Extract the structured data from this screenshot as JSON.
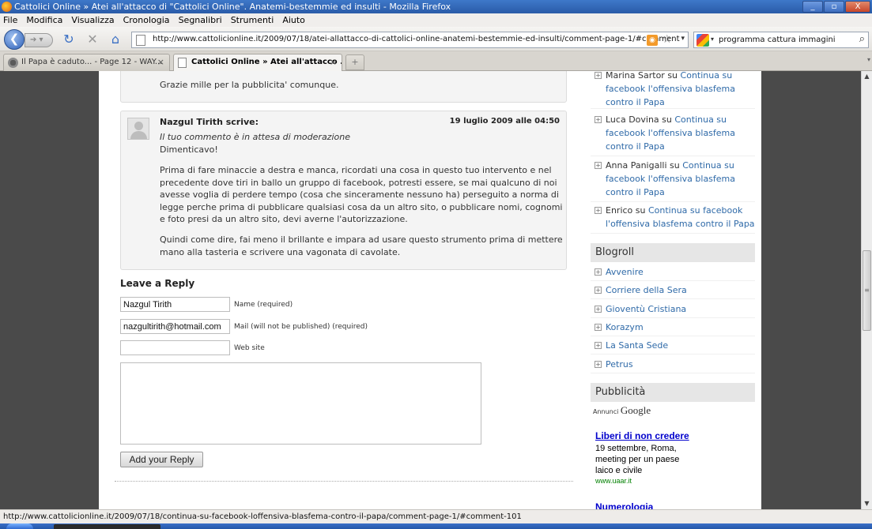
{
  "window": {
    "title": "Cattolici Online » Atei all'attacco di \"Cattolici Online\". Anatemi-bestemmie ed insulti - Mozilla Firefox",
    "minimize": "_",
    "maximize": "▫",
    "close": "X"
  },
  "menu": [
    "File",
    "Modifica",
    "Visualizza",
    "Cronologia",
    "Segnalibri",
    "Strumenti",
    "Aiuto"
  ],
  "nav": {
    "url": "http://www.cattolicionline.it/2009/07/18/atei-allattacco-di-cattolici-online-anatemi-bestemmie-ed-insulti/comment-page-1/#comment",
    "search_value": "programma cattura immagini"
  },
  "tabs": [
    {
      "label": "Il Papa è caduto... - Page 12 - WAY...",
      "close": "×"
    },
    {
      "label": "Cattolici Online » Atei all'attacco ...",
      "close": "×"
    }
  ],
  "new_tab": "+",
  "prev_comment": {
    "text": "Grazie mille per la pubblicita' comunque."
  },
  "comment": {
    "author": "Nazgul Tirith scrive:",
    "date": "19 luglio 2009 alle 04:50",
    "moderation": "Il tuo commento è in attesa di moderazione",
    "line1": "Dimenticavo!",
    "para1": "Prima di fare minaccie a destra e manca, ricordati una cosa in questo tuo intervento e nel precedente dove tiri in ballo un gruppo di facebook, potresti essere, se mai qualcuno di noi avesse voglia di perdere tempo (cosa che sinceramente nessuno ha) perseguito a norma di legge perche prima di pubblicare qualsiasi cosa da un altro sito, o pubblicare nomi, cognomi e foto presi da un altro sito, devi averne l'autorizzazione.",
    "para2": "Quindi come dire, fai meno il brillante e impara ad usare questo strumento prima di mettere mano alla tasteria e scrivere una vagonata di cavolate."
  },
  "reply": {
    "title": "Leave a Reply",
    "name_value": "Nazgul Tirith",
    "name_label": "Name (required)",
    "mail_value": "nazgultirith@hotmail.com",
    "mail_label": "Mail (will not be published) (required)",
    "website_value": "",
    "website_label": "Web site",
    "submit_label": "Add your Reply"
  },
  "sidebar": {
    "recent_comments": [
      {
        "who": "Marina Sartor su ",
        "link": "Continua su facebook l'offensiva blasfema contro il Papa"
      },
      {
        "who": "Luca Dovina su ",
        "link": "Continua su facebook l'offensiva blasfema contro il Papa"
      },
      {
        "who": "Anna Panigalli su ",
        "link": "Continua su facebook l'offensiva blasfema contro il Papa"
      },
      {
        "who": "Enrico su ",
        "link": "Continua su facebook l'offensiva blasfema contro il Papa"
      }
    ],
    "blogroll_title": "Blogroll",
    "blogroll": [
      "Avvenire",
      "Corriere della Sera",
      "Gioventù Cristiana",
      "Korazym",
      "La Santa Sede",
      "Petrus"
    ],
    "pubblicita_title": "Pubblicità",
    "adsense_prefix": "Annunci",
    "adsense_brand": "Google",
    "ad": {
      "title": "Liberi di non credere",
      "text": "19 settembre, Roma, meeting per un paese laico e civile",
      "url": "www.uaar.it"
    },
    "ad2_title": "Numerologia"
  },
  "status": {
    "text": "http://www.cattolicionline.it/2009/07/18/continua-su-facebook-loffensiva-blasfema-contro-il-papa/comment-page-1/#comment-101"
  },
  "colors": {
    "link": "#2f6aa8",
    "ad_link": "#0000cc",
    "ad_url": "#008000",
    "titlebar": "#2a5ba8"
  }
}
